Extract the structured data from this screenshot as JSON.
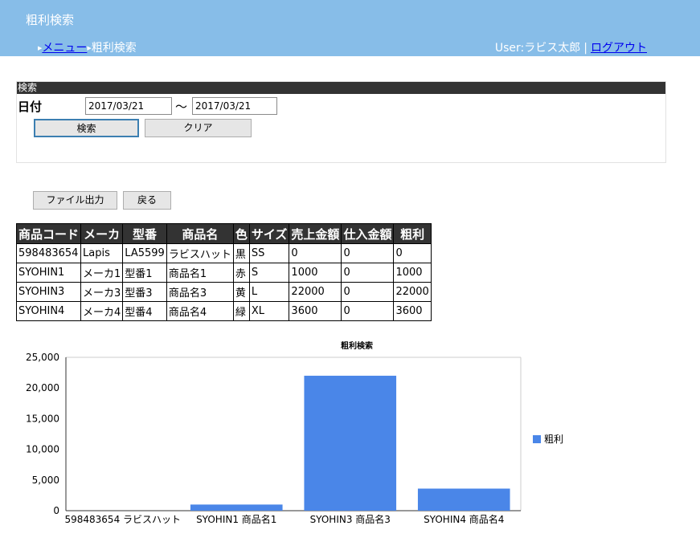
{
  "header": {
    "title": "粗利検索",
    "breadcrumb": {
      "menu_link": "メニュー",
      "current": "粗利検索"
    },
    "user": {
      "label": "User:ラビス太郎",
      "separator": "|",
      "logout": "ログアウト"
    }
  },
  "search": {
    "section_title": "検索",
    "date_label": "日付",
    "date_from": "2017/03/21",
    "tilde": "～",
    "date_to": "2017/03/21",
    "search_button": "検索",
    "clear_button": "クリア"
  },
  "actions": {
    "export_button": "ファイル出力",
    "back_button": "戻る"
  },
  "table": {
    "columns": [
      "商品コード",
      "メーカ",
      "型番",
      "商品名",
      "色",
      "サイズ",
      "売上金額",
      "仕入金額",
      "粗利"
    ],
    "rows": [
      [
        "598483654",
        "Lapis",
        "LA5599",
        "ラビスハット",
        "黒",
        "SS",
        "0",
        "0",
        "0"
      ],
      [
        "SYOHIN1",
        "メーカ1",
        "型番1",
        "商品名1",
        "赤",
        "S",
        "1000",
        "0",
        "1000"
      ],
      [
        "SYOHIN3",
        "メーカ3",
        "型番3",
        "商品名3",
        "黄",
        "L",
        "22000",
        "0",
        "22000"
      ],
      [
        "SYOHIN4",
        "メーカ4",
        "型番4",
        "商品名4",
        "緑",
        "XL",
        "3600",
        "0",
        "3600"
      ]
    ]
  },
  "chart_data": {
    "type": "bar",
    "title": "粗利検索",
    "categories": [
      "598483654 ラビスハット",
      "SYOHIN1 商品名1",
      "SYOHIN3 商品名3",
      "SYOHIN4 商品名4"
    ],
    "series": [
      {
        "name": "粗利",
        "values": [
          0,
          1000,
          22000,
          3600
        ],
        "color": "#4a86e8"
      }
    ],
    "yticks": [
      "0",
      "5,000",
      "10,000",
      "15,000",
      "20,000",
      "25,000"
    ],
    "ylim": [
      0,
      25000
    ],
    "grid": false,
    "legend": "right"
  }
}
